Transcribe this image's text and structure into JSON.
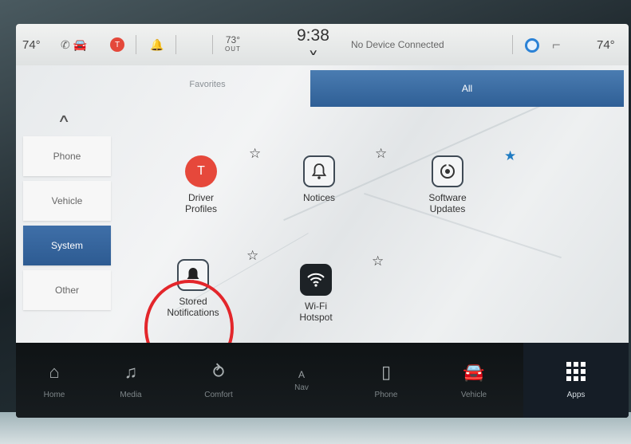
{
  "status": {
    "temp_left": "74°",
    "notification_badge": "T",
    "outside_temp": "73°",
    "outside_label": "OUT",
    "time": "9:38",
    "device_status": "No Device Connected",
    "temp_right": "74°"
  },
  "tabs": {
    "favorites": "Favorites",
    "all": "All"
  },
  "categories": [
    {
      "label": "Phone",
      "active": false
    },
    {
      "label": "Vehicle",
      "active": false
    },
    {
      "label": "System",
      "active": true
    },
    {
      "label": "Other",
      "active": false
    }
  ],
  "apps": [
    {
      "label": "Driver\nProfiles",
      "icon": "driver-profile-icon",
      "initial": "T",
      "favorite": false
    },
    {
      "label": "Notices",
      "icon": "bell-icon",
      "favorite": false
    },
    {
      "label": "Software\nUpdates",
      "icon": "software-update-icon",
      "favorite": true
    },
    {
      "label": "Stored\nNotifications",
      "icon": "bell-filled-icon",
      "favorite": false,
      "highlighted": true
    },
    {
      "label": "Wi-Fi\nHotspot",
      "icon": "wifi-icon",
      "favorite": false
    }
  ],
  "nav": {
    "home": "Home",
    "media": "Media",
    "comfort": "Comfort",
    "nav": "Nav",
    "nav_direction": "A",
    "phone": "Phone",
    "vehicle": "Vehicle",
    "apps": "Apps"
  },
  "colors": {
    "accent_blue": "#2f5f96",
    "favorite_star": "#1f7bc2",
    "badge_red": "#e6483b",
    "highlight_circle": "#e3262b"
  }
}
